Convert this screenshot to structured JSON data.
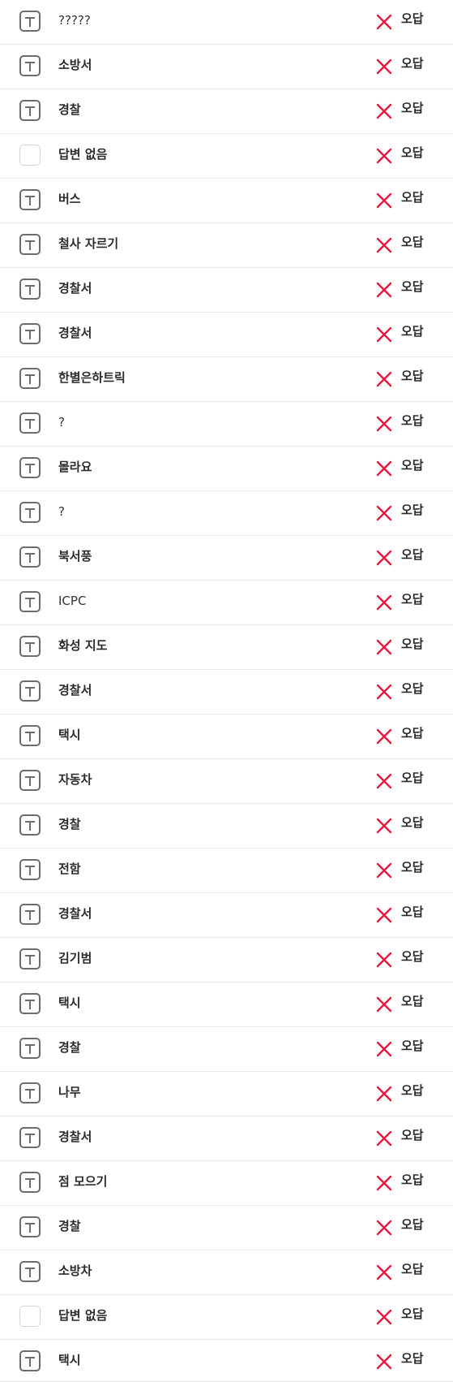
{
  "icons": {
    "text_type": "text-type-icon",
    "empty": "empty-checkbox-icon",
    "wrong": "x-mark-icon"
  },
  "colors": {
    "wrong_mark": "#e8193c",
    "text_icon": "#6c6c6c"
  },
  "responses": [
    {
      "answer": "?????",
      "type": "text",
      "result": "오답"
    },
    {
      "answer": "소방서",
      "type": "text",
      "result": "오답"
    },
    {
      "answer": "경찰",
      "type": "text",
      "result": "오답"
    },
    {
      "answer": "답변 없음",
      "type": "empty",
      "result": "오답"
    },
    {
      "answer": "버스",
      "type": "text",
      "result": "오답"
    },
    {
      "answer": "철사 자르기",
      "type": "text",
      "result": "오답"
    },
    {
      "answer": "경찰서",
      "type": "text",
      "result": "오답"
    },
    {
      "answer": "경찰서",
      "type": "text",
      "result": "오답"
    },
    {
      "answer": "한별은하트릭",
      "type": "text",
      "result": "오답"
    },
    {
      "answer": "?",
      "type": "text",
      "result": "오답"
    },
    {
      "answer": "몰라요",
      "type": "text",
      "result": "오답"
    },
    {
      "answer": "?",
      "type": "text",
      "result": "오답"
    },
    {
      "answer": "북서풍",
      "type": "text",
      "result": "오답"
    },
    {
      "answer": "ICPC",
      "type": "text",
      "result": "오답"
    },
    {
      "answer": "화성 지도",
      "type": "text",
      "result": "오답"
    },
    {
      "answer": "경찰서",
      "type": "text",
      "result": "오답"
    },
    {
      "answer": "택시",
      "type": "text",
      "result": "오답"
    },
    {
      "answer": "자동차",
      "type": "text",
      "result": "오답"
    },
    {
      "answer": "경찰",
      "type": "text",
      "result": "오답"
    },
    {
      "answer": "전함",
      "type": "text",
      "result": "오답"
    },
    {
      "answer": "경찰서",
      "type": "text",
      "result": "오답"
    },
    {
      "answer": "김기범",
      "type": "text",
      "result": "오답"
    },
    {
      "answer": "택시",
      "type": "text",
      "result": "오답"
    },
    {
      "answer": "경찰",
      "type": "text",
      "result": "오답"
    },
    {
      "answer": "나무",
      "type": "text",
      "result": "오답"
    },
    {
      "answer": "경찰서",
      "type": "text",
      "result": "오답"
    },
    {
      "answer": "점 모으기",
      "type": "text",
      "result": "오답"
    },
    {
      "answer": "경찰",
      "type": "text",
      "result": "오답"
    },
    {
      "answer": "소방차",
      "type": "text",
      "result": "오답"
    },
    {
      "answer": "답변 없음",
      "type": "empty",
      "result": "오답"
    },
    {
      "answer": "택시",
      "type": "text",
      "result": "오답"
    }
  ]
}
